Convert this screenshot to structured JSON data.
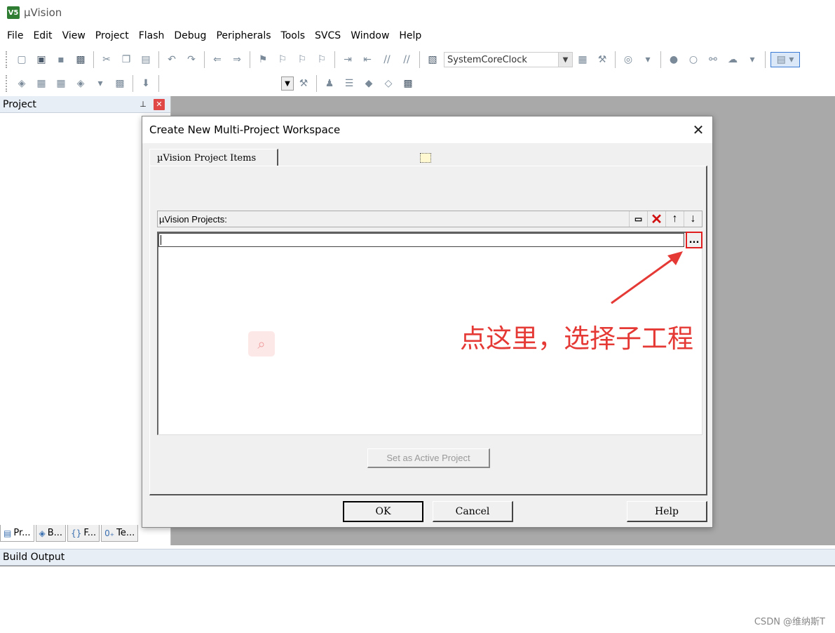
{
  "window": {
    "title": "µVision",
    "icon_text": "V5"
  },
  "menu": [
    "File",
    "Edit",
    "View",
    "Project",
    "Flash",
    "Debug",
    "Peripherals",
    "Tools",
    "SVCS",
    "Window",
    "Help"
  ],
  "toolbar": {
    "combo_value": "SystemCoreClock"
  },
  "project_panel": {
    "title": "Project",
    "tabs": [
      {
        "icon": "▤",
        "label": "Pr..."
      },
      {
        "icon": "◈",
        "label": "B..."
      },
      {
        "icon": "{}",
        "label": "F..."
      },
      {
        "icon": "0₊",
        "label": "Te..."
      }
    ]
  },
  "build_output": {
    "title": "Build Output"
  },
  "watermark": "CSDN @维纳斯T",
  "dialog": {
    "title": "Create New Multi-Project Workspace",
    "close": "✕",
    "tab_label": "µVision Project Items",
    "list_label": "µVision Projects:",
    "list_buttons": {
      "new": "▭",
      "delete": "✕",
      "up": "↑",
      "down": "↓"
    },
    "browse_label": "...",
    "annotation": "点这里，选择子工程",
    "set_active_label": "Set as Active Project",
    "ok_label": "OK",
    "cancel_label": "Cancel",
    "help_label": "Help"
  },
  "colors": {
    "annotation": "#e53935",
    "workarea": "#a9a9a9",
    "highlight": "#e02020"
  }
}
